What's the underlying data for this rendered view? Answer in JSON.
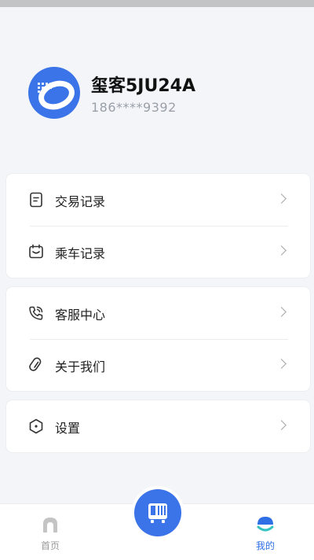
{
  "profile": {
    "nickname": "玺客5JU24A",
    "phone": "186****9392"
  },
  "menu_groups": [
    [
      {
        "label": "交易记录",
        "icon": "receipt-icon"
      },
      {
        "label": "乘车记录",
        "icon": "ride-ticket-icon"
      }
    ],
    [
      {
        "label": "客服中心",
        "icon": "phone-icon"
      },
      {
        "label": "关于我们",
        "icon": "link-icon"
      }
    ],
    [
      {
        "label": "设置",
        "icon": "hexagon-settings-icon"
      }
    ]
  ],
  "bottom_nav": {
    "home_label": "首页",
    "mine_label": "我的",
    "active": "我的"
  },
  "colors": {
    "accent": "#3b73e8",
    "active_tab": "#2f6fe6",
    "background": "#f3f5f9"
  }
}
